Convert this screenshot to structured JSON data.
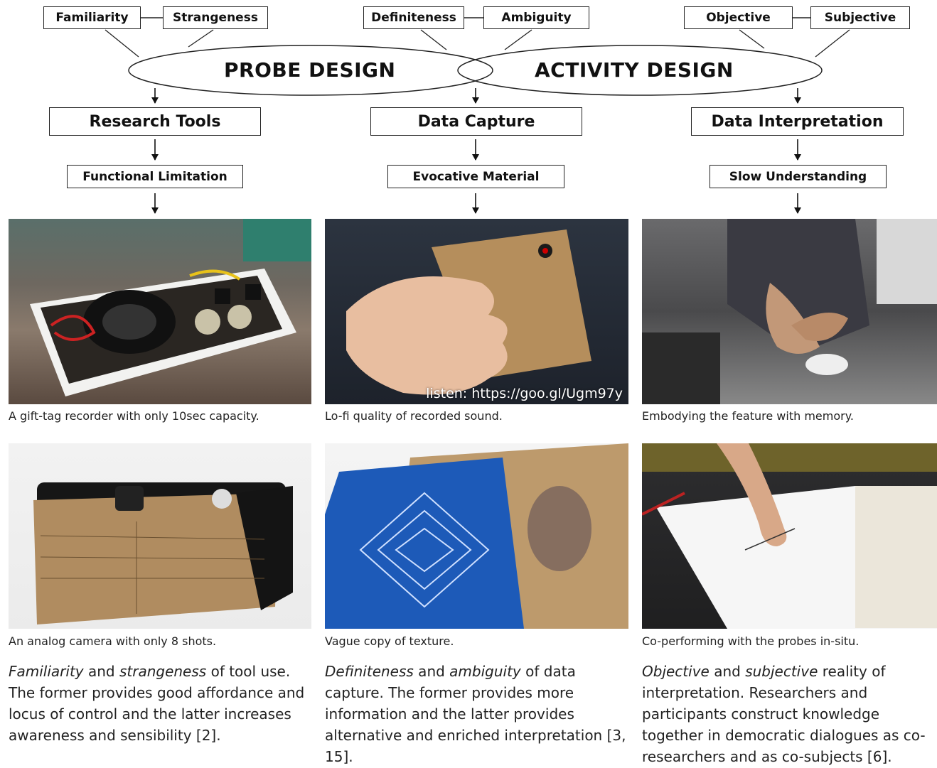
{
  "top_pairs": {
    "left": [
      "Familiarity",
      "Strangeness"
    ],
    "center": [
      "Definiteness",
      "Ambiguity"
    ],
    "right": [
      "Objective",
      "Subjective"
    ]
  },
  "ellipses": {
    "probe": "PROBE DESIGN",
    "activity": "ACTIVITY DESIGN"
  },
  "stages": {
    "left": "Research Tools",
    "center": "Data Capture",
    "right": "Data Interpretation"
  },
  "qualities": {
    "left": "Functional Limitation",
    "center": "Evocative Material",
    "right": "Slow Understanding"
  },
  "photos": {
    "row1": {
      "left": "A gift-tag recorder with only 10sec capacity.",
      "center": "Lo-fi quality of recorded sound.",
      "center_overlay": "listen: https://goo.gl/Ugm97y",
      "right": "Embodying the feature with memory."
    },
    "row2": {
      "left": "An analog camera with only 8 shots.",
      "center": "Vague copy of texture.",
      "right": "Co-performing with the probes in-situ."
    }
  },
  "paragraphs": {
    "left": {
      "term1": "Familiarity",
      "and": " and ",
      "term2": "strangeness",
      "rest": " of tool use. The former provides good affordance and locus of control and the latter increases awareness and sensibility [2]."
    },
    "center": {
      "term1": "Definiteness",
      "and": " and ",
      "term2": "ambiguity",
      "rest": " of data capture. The former provides more information and the latter provides alternative and enriched interpretation [3, 15]."
    },
    "right": {
      "term1": "Objective",
      "and": " and ",
      "term2": "subjective",
      "rest": " reality of interpretation. Researchers and participants construct knowledge together in democratic dialogues as co-researchers and as co-subjects [6]."
    }
  }
}
